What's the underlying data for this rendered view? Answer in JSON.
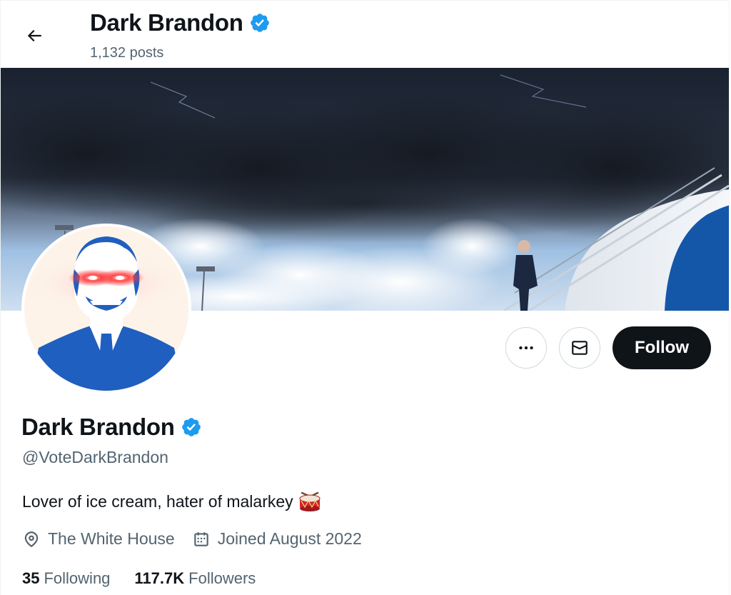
{
  "header": {
    "title": "Dark Brandon",
    "posts_count": "1,132 posts"
  },
  "profile": {
    "display_name": "Dark Brandon",
    "handle": "@VoteDarkBrandon",
    "bio": "Lover of ice cream, hater of malarkey",
    "bio_emoji": "drum-icon",
    "location": "The White House",
    "joined": "Joined August 2022",
    "verified_color": "#1d9bf0"
  },
  "actions": {
    "more_icon": "more-horizontal-icon",
    "message_icon": "envelope-icon",
    "follow_label": "Follow"
  },
  "stats": {
    "following_count": "35",
    "following_label": "Following",
    "followers_count": "117.7K",
    "followers_label": "Followers"
  },
  "colors": {
    "text_primary": "#0f1419",
    "text_secondary": "#536471",
    "follow_bg": "#0f1419",
    "avatar_blue": "#1f5fbf",
    "laser_red": "#ff2a2a"
  }
}
